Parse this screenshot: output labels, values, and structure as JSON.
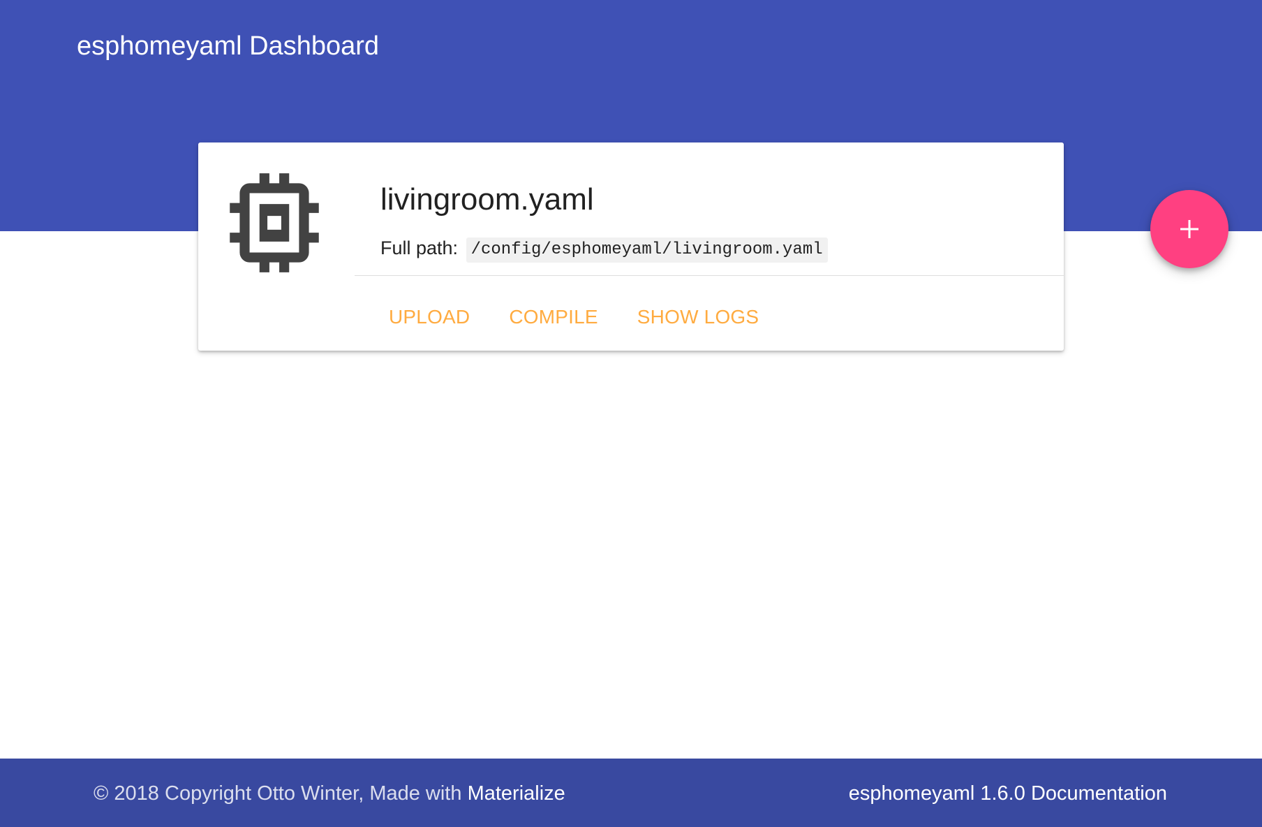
{
  "header": {
    "title": "esphomeyaml Dashboard",
    "color": "#3f51b5"
  },
  "cards": [
    {
      "icon": "chip-icon",
      "title": "livingroom.yaml",
      "path_label": "Full path:",
      "path": "/config/esphomeyaml/livingroom.yaml",
      "actions": [
        "UPLOAD",
        "COMPILE",
        "SHOW LOGS"
      ]
    }
  ],
  "fab": {
    "icon": "plus-icon",
    "color": "#ff4081"
  },
  "footer": {
    "copyright_prefix": "© 2018 Copyright Otto Winter, Made with ",
    "materialize_link": "Materialize",
    "version_text": "esphomeyaml 1.6.0",
    "documentation_link": "Documentation"
  },
  "colors": {
    "accent": "#ffab40",
    "footer": "#3949a0"
  }
}
